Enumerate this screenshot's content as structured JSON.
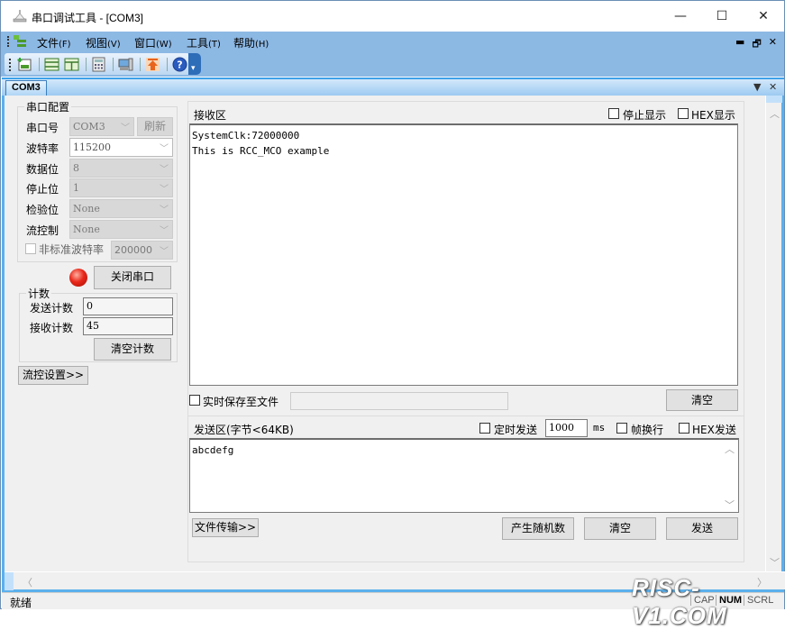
{
  "window": {
    "title": "串口调试工具 - [COM3]",
    "controls": {
      "minimize": "—",
      "maximize": "☐",
      "close": "✕"
    }
  },
  "menubar": {
    "items": [
      {
        "label": "文件",
        "key": "(F)"
      },
      {
        "label": "视图",
        "key": "(V)"
      },
      {
        "label": "窗口",
        "key": "(W)"
      },
      {
        "label": "工具",
        "key": "(T)"
      },
      {
        "label": "帮助",
        "key": "(H)"
      }
    ],
    "mdi_controls": {
      "minimize": "▬",
      "restore": "🗗",
      "close": "✕"
    }
  },
  "toolbar": {
    "icons": [
      "new-window-icon",
      "split-horizontal-icon",
      "split-vertical-icon",
      "calculator-icon",
      "computer-icon",
      "upload-icon",
      "help-icon"
    ],
    "overflow": "▾"
  },
  "tabs": {
    "items": [
      {
        "label": "COM3",
        "active": true
      }
    ],
    "dropdown": "▼",
    "close": "✕"
  },
  "serial_config": {
    "title": "串口配置",
    "port": {
      "label": "串口号",
      "value": "COM3",
      "refresh_label": "刷新"
    },
    "baud": {
      "label": "波特率",
      "value": "115200"
    },
    "data_bits": {
      "label": "数据位",
      "value": "8"
    },
    "stop_bits": {
      "label": "停止位",
      "value": "1"
    },
    "parity": {
      "label": "检验位",
      "value": "None"
    },
    "flow": {
      "label": "流控制",
      "value": "None"
    },
    "custom_baud": {
      "label": "非标准波特率",
      "checked": false,
      "value": "200000"
    },
    "close_port_label": "关闭串口",
    "port_status_color": "#e8281a"
  },
  "counter": {
    "title": "计数",
    "sent_label": "发送计数",
    "sent_value": "0",
    "recv_label": "接收计数",
    "recv_value": "45",
    "clear_label": "清空计数"
  },
  "flow_settings_label": "流控设置>>",
  "receive": {
    "title": "接收区",
    "stop_display": {
      "label": "停止显示",
      "checked": false
    },
    "hex_display": {
      "label": "HEX显示",
      "checked": false
    },
    "content": "SystemClk:72000000\nThis is RCC_MCO example",
    "save_to_file": {
      "label": "实时保存至文件",
      "checked": false,
      "path": ""
    },
    "clear_label": "清空"
  },
  "send": {
    "title": "发送区(字节<64KB)",
    "timed_send": {
      "label": "定时发送",
      "checked": false
    },
    "interval": "1000",
    "interval_unit": "ms",
    "newline": {
      "label": "帧换行",
      "checked": false
    },
    "hex_send": {
      "label": "HEX发送",
      "checked": false
    },
    "content": "abcdefg",
    "file_transfer_label": "文件传输>>",
    "random_label": "产生随机数",
    "clear_label": "清空",
    "send_label": "发送"
  },
  "statusbar": {
    "text": "就绪",
    "indicators": [
      "CAP",
      "NUM",
      "SCRL"
    ]
  },
  "watermark": "RISC-V1.COM"
}
